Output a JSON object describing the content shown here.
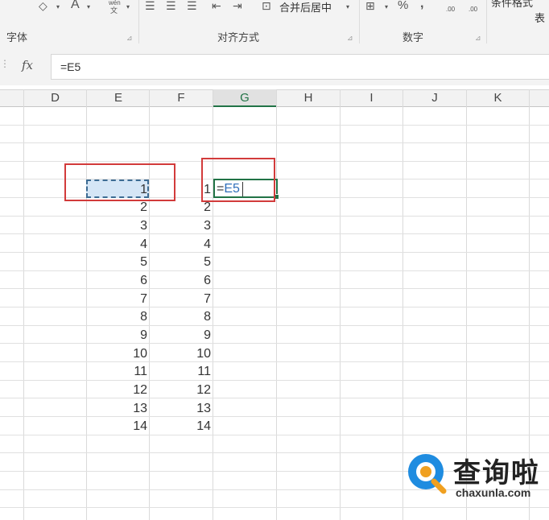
{
  "ribbon": {
    "groups": [
      {
        "label": "字体"
      },
      {
        "label": "对齐方式"
      },
      {
        "label": "数字"
      }
    ],
    "font_color_icon": "A",
    "wen_icon_top": "wén",
    "wen_icon_bottom": "文",
    "merge_center_label": "合并后居中",
    "percent_icon": "%",
    "comma_icon": ",",
    "increase_decimal": ".00",
    "conditional_format_label": "条件格式",
    "table_label_partial": "表"
  },
  "formula_bar": {
    "fx_label": "fx",
    "value": "=E5"
  },
  "grid": {
    "columns": [
      "D",
      "E",
      "F",
      "G",
      "H",
      "I",
      "J",
      "K"
    ],
    "selected_column": "G",
    "column_e_values": [
      "1",
      "2",
      "3",
      "4",
      "5",
      "6",
      "7",
      "8",
      "9",
      "10",
      "11",
      "12",
      "13",
      "14"
    ],
    "column_f_values": [
      "1",
      "2",
      "3",
      "4",
      "5",
      "6",
      "7",
      "8",
      "9",
      "10",
      "11",
      "12",
      "13",
      "14"
    ],
    "active_cell_formula": {
      "eq": "=",
      "ref": "E5"
    }
  },
  "watermark": {
    "text": "查询啦",
    "url": "chaxunla.com"
  },
  "colors": {
    "accent_green": "#217346",
    "highlight_red": "#d23b3b",
    "reference_blue": "#2f6fba"
  }
}
